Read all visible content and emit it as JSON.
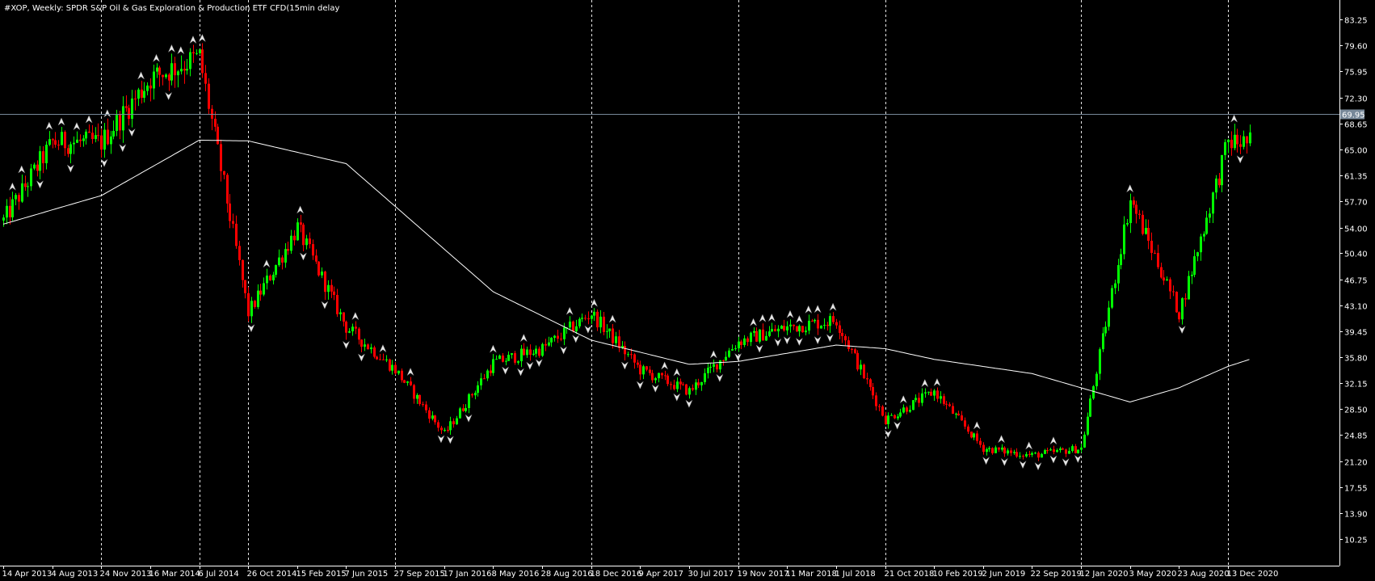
{
  "chart_data": {
    "type": "candlestick",
    "title": "#XOP, Weekly:  SPDR S&P Oil & Gas Exploration & Production ETF CFD(15min delay",
    "current_price": 69.95,
    "ylim": [
      6.5,
      86.0
    ],
    "y_ticks": [
      "83.25",
      "79.60",
      "75.95",
      "72.30",
      "68.65",
      "65.00",
      "61.35",
      "57.70",
      "54.00",
      "50.40",
      "46.75",
      "43.10",
      "39.45",
      "35.80",
      "32.15",
      "28.50",
      "24.85",
      "21.20",
      "17.55",
      "13.90",
      "10.25"
    ],
    "x_ticks": [
      "14 Apr 2013",
      "4 Aug 2013",
      "24 Nov 2013",
      "16 Mar 2014",
      "6 Jul 2014",
      "26 Oct 2014",
      "15 Feb 2015",
      "7 Jun 2015",
      "27 Sep 2015",
      "17 Jan 2016",
      "8 May 2016",
      "28 Aug 2016",
      "18 Dec 2016",
      "9 Apr 2017",
      "30 Jul 2017",
      "19 Nov 2017",
      "11 Mar 2018",
      "1 Jul 2018",
      "21 Oct 2018",
      "10 Feb 2019",
      "2 Jun 2019",
      "22 Sep 2019",
      "12 Jan 2020",
      "3 May 2020",
      "23 Aug 2020",
      "13 Dec 2020"
    ],
    "grid": "vertical dashed at 9 dates",
    "vgrid_dates": [
      "24 Nov 2013",
      "6 Jul 2014",
      "26 Oct 2014",
      "27 Sep 2015",
      "18 Dec 2016",
      "19 Nov 2017",
      "21 Oct 2018",
      "12 Jan 2020",
      "13 Dec 2020"
    ],
    "close_path": [
      [
        "14 Apr 2013",
        55
      ],
      [
        "4 Aug 2013",
        66
      ],
      [
        "24 Nov 2013",
        66
      ],
      [
        "16 Mar 2014",
        75
      ],
      [
        "6 Jul 2014",
        78
      ],
      [
        "26 Oct 2014",
        42
      ],
      [
        "15 Feb 2015",
        54
      ],
      [
        "7 Jun 2015",
        40
      ],
      [
        "27 Sep 2015",
        34
      ],
      [
        "17 Jan 2016",
        25
      ],
      [
        "8 May 2016",
        35
      ],
      [
        "28 Aug 2016",
        37
      ],
      [
        "18 Dec 2016",
        42
      ],
      [
        "9 Apr 2017",
        34
      ],
      [
        "30 Jul 2017",
        31
      ],
      [
        "19 Nov 2017",
        38
      ],
      [
        "11 Mar 2018",
        40
      ],
      [
        "1 Jul 2018",
        41
      ],
      [
        "21 Oct 2018",
        27
      ],
      [
        "10 Feb 2019",
        31
      ],
      [
        "2 Jun 2019",
        23
      ],
      [
        "22 Sep 2019",
        22
      ],
      [
        "12 Jan 2020",
        23
      ],
      [
        "3 May 2020",
        58
      ],
      [
        "23 Aug 2020",
        42
      ],
      [
        "13 Dec 2020",
        66
      ]
    ],
    "moving_average": [
      [
        "14 Apr 2013",
        54.5
      ],
      [
        "24 Nov 2013",
        58.5
      ],
      [
        "6 Jul 2014",
        66.3
      ],
      [
        "26 Oct 2014",
        66.2
      ],
      [
        "7 Jun 2015",
        63
      ],
      [
        "27 Sep 2015",
        57
      ],
      [
        "8 May 2016",
        45
      ],
      [
        "18 Dec 2016",
        38.2
      ],
      [
        "30 Jul 2017",
        34.8
      ],
      [
        "19 Nov 2017",
        35.2
      ],
      [
        "1 Jul 2018",
        37.5
      ],
      [
        "21 Oct 2018",
        37.0
      ],
      [
        "10 Feb 2019",
        35.5
      ],
      [
        "22 Sep 2019",
        33.5
      ],
      [
        "12 Jan 2020",
        31.5
      ],
      [
        "3 May 2020",
        29.5
      ],
      [
        "23 Aug 2020",
        31.5
      ],
      [
        "13 Dec 2020",
        34.5
      ],
      [
        "1 Feb 2021",
        35.5
      ]
    ],
    "colors": {
      "up": "#00ff00",
      "down": "#ff0000",
      "ma": "#ffffff",
      "background": "#000000",
      "grid": "#ffffff",
      "price_label_bg": "#778899"
    }
  }
}
